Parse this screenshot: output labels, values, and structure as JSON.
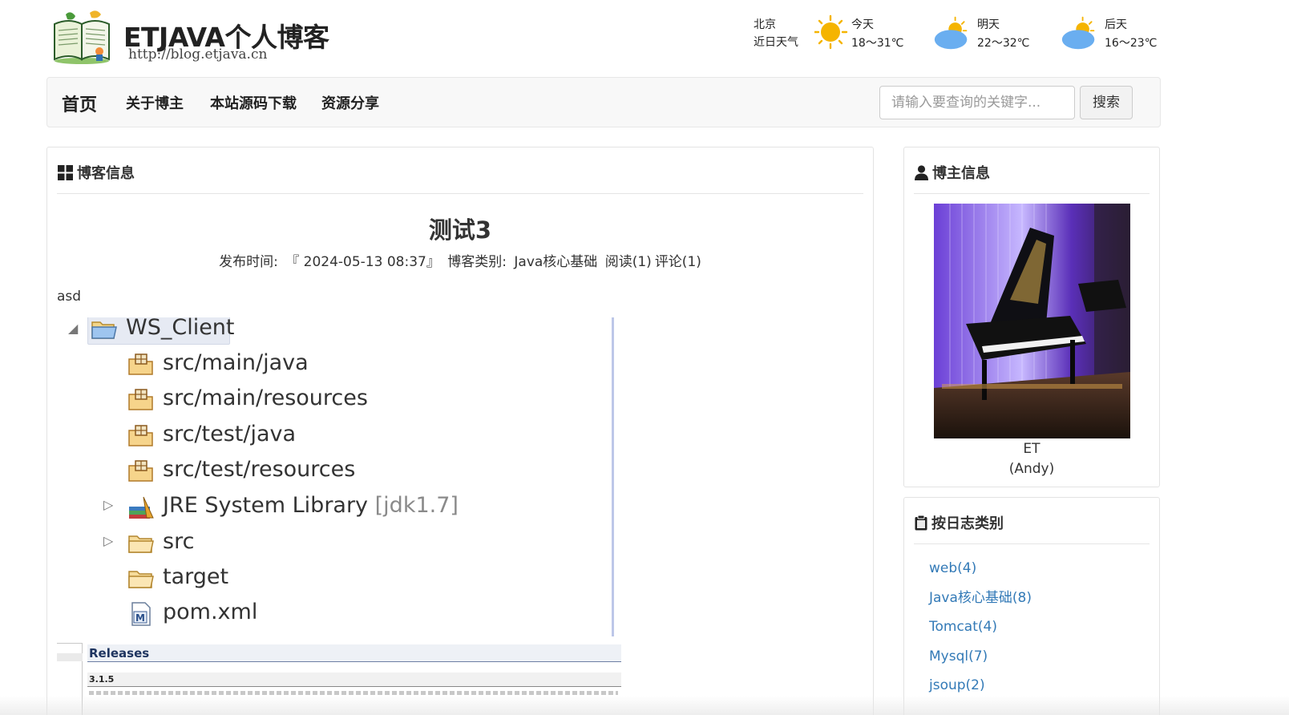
{
  "header": {
    "logo_title": "ETJAVA个人博客",
    "logo_url": "http://blog.etjava.cn"
  },
  "weather": {
    "city": "北京",
    "caption": "近日天气",
    "days": [
      {
        "label": "今天",
        "temp": "18～31℃",
        "icon": "sun-icon"
      },
      {
        "label": "明天",
        "temp": "22～32℃",
        "icon": "partly-cloudy-icon"
      },
      {
        "label": "后天",
        "temp": "16～23℃",
        "icon": "partly-cloudy-icon"
      }
    ]
  },
  "nav": {
    "items": [
      "首页",
      "关于博主",
      "本站源码下载",
      "资源分享"
    ],
    "search_placeholder": "请输入要查询的关键字...",
    "search_button": "搜索"
  },
  "blog_panel": {
    "heading": "博客信息",
    "post": {
      "title": "测试3",
      "meta_time_label": "发布时间:",
      "meta_time": "『 2024-05-13 08:37』",
      "meta_category_label": "博客类别:",
      "meta_category": "Java核心基础",
      "meta_reads": "阅读(1)",
      "meta_comments": "评论(1)",
      "body_text": "asd"
    },
    "tree": {
      "root": "WS_Client",
      "items": [
        {
          "label": "src/main/java",
          "icon": "package-folder-icon"
        },
        {
          "label": "src/main/resources",
          "icon": "package-folder-icon"
        },
        {
          "label": "src/test/java",
          "icon": "package-folder-icon"
        },
        {
          "label": "src/test/resources",
          "icon": "package-folder-icon"
        },
        {
          "label": "JRE System Library",
          "suffix": "[jdk1.7]",
          "icon": "library-icon"
        },
        {
          "label": "src",
          "icon": "folder-icon"
        },
        {
          "label": "target",
          "icon": "folder-icon"
        },
        {
          "label": "pom.xml",
          "icon": "maven-file-icon"
        }
      ]
    },
    "releases": {
      "heading": "Releases",
      "version": "3.1.5"
    }
  },
  "author_panel": {
    "heading": "博主信息",
    "name_line1": "ET",
    "name_line2": "(Andy)"
  },
  "category_panel": {
    "heading": "按日志类别",
    "items": [
      "web(4)",
      "Java核心基础(8)",
      "Tomcat(4)",
      "Mysql(7)",
      "jsoup(2)"
    ]
  },
  "colors": {
    "link": "#337ab7",
    "nav_bg": "#f8f8f8",
    "sun": "#f5b400",
    "cloud": "#6aaef0"
  }
}
